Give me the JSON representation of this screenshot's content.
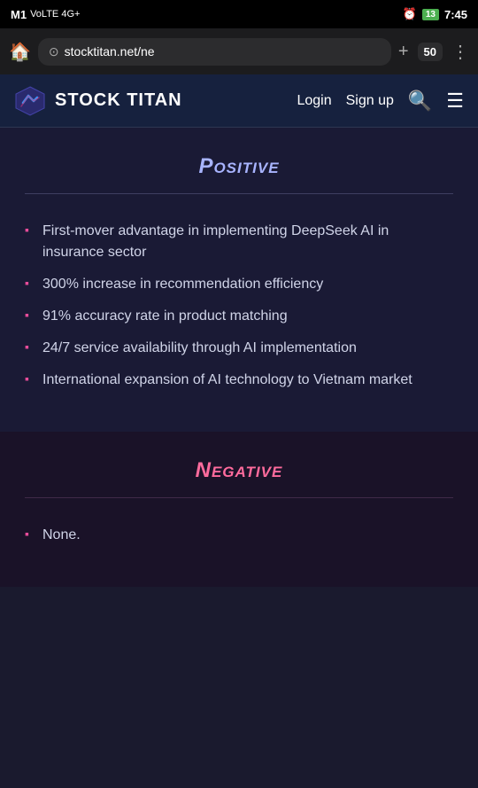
{
  "statusBar": {
    "carrier": "M1",
    "networkType": "VoLTE 4G+",
    "alarmIcon": "alarm-icon",
    "batteryLevel": "13",
    "time": "7:45"
  },
  "browserBar": {
    "homeIcon": "⌂",
    "url": "stocktitan.net/ne",
    "plusIcon": "+",
    "tabsCount": "50",
    "menuIcon": "⋮"
  },
  "navBar": {
    "title": "STOCK TITAN",
    "loginLabel": "Login",
    "signupLabel": "Sign up"
  },
  "positiveSection": {
    "title": "Positive",
    "bullets": [
      "First-mover advantage in implementing DeepSeek AI in insurance sector",
      "300% increase in recommendation efficiency",
      "91% accuracy rate in product matching",
      "24/7 service availability through AI implementation",
      "International expansion of AI technology to Vietnam market"
    ]
  },
  "negativeSection": {
    "title": "Negative",
    "bullets": [
      "None."
    ]
  }
}
